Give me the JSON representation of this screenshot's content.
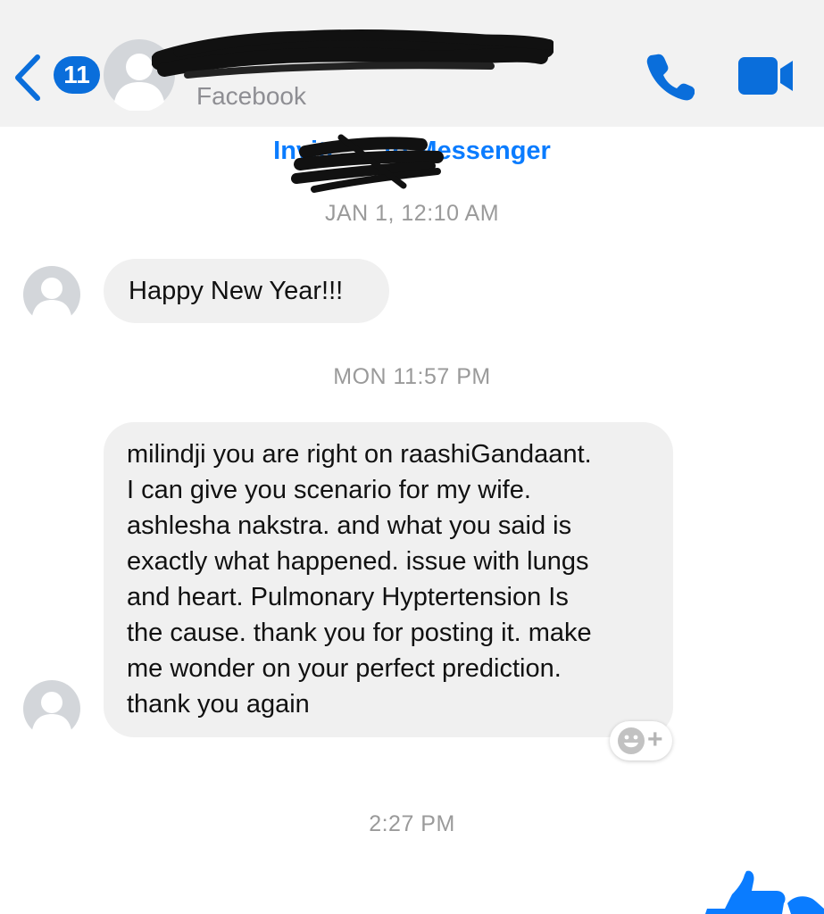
{
  "header": {
    "back_count": "11",
    "contact_subtitle": "Facebook"
  },
  "invite": {
    "prefix": "Invite",
    "suffix": "to Messenger"
  },
  "thread": {
    "timestamp_1": "JAN 1, 12:10 AM",
    "message_1": "Happy New Year!!!",
    "timestamp_2": "MON 11:57 PM",
    "message_2_lines": [
      "milindji you are right on raashiGandaant.",
      "I can give you scenario for my wife.",
      "ashlesha nakstra. and what you said is",
      "exactly what happened. issue with lungs",
      "and heart. Pulmonary Hyptertension Is",
      "the cause. thank you for posting it. make",
      "me wonder on your perfect prediction.",
      "thank you again"
    ],
    "timestamp_3": "2:27 PM"
  },
  "icons": {
    "back": "chevron-left-icon",
    "phone": "phone-icon",
    "video": "video-camera-icon",
    "react": "smiley-add-reaction-icon",
    "like": "thumbs-up-icon",
    "avatar": "default-profile-avatar"
  },
  "colors": {
    "accent": "#0a7cff",
    "header_icons": "#0a6edb",
    "bubble": "#f0f0f0",
    "timestamp": "#9a9a9a"
  }
}
